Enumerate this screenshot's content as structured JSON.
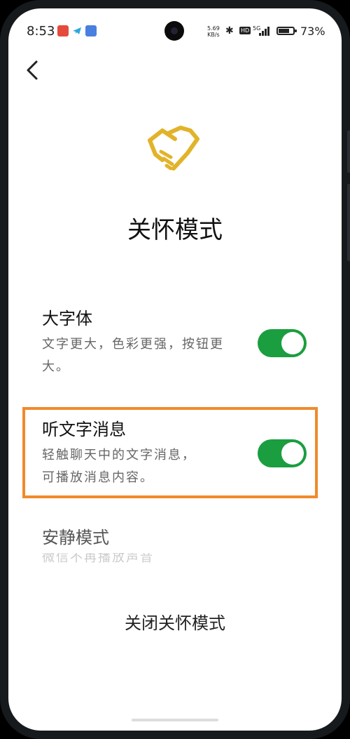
{
  "status_bar": {
    "time": "8:53",
    "net_speed_value": "5.69",
    "net_speed_unit": "KB/s",
    "hd_label": "HD",
    "signal_label": "5G",
    "battery_percent": "73",
    "battery_level": 0.73
  },
  "page": {
    "title": "关怀模式"
  },
  "settings": [
    {
      "title": "大字体",
      "description": "文字更大，色彩更强，按钮更大。",
      "enabled": true
    },
    {
      "title": "听文字消息",
      "description_line1": "轻触聊天中的文字消息，",
      "description_line2": "可播放消息内容。",
      "enabled": true
    },
    {
      "title": "安静模式",
      "description": "微信不再播放声音"
    }
  ],
  "footer": {
    "close_label": "关闭关怀模式"
  },
  "colors": {
    "toggle_on": "#1a9e3f",
    "highlight": "#f08a2c",
    "logo": "#e2b32a"
  }
}
